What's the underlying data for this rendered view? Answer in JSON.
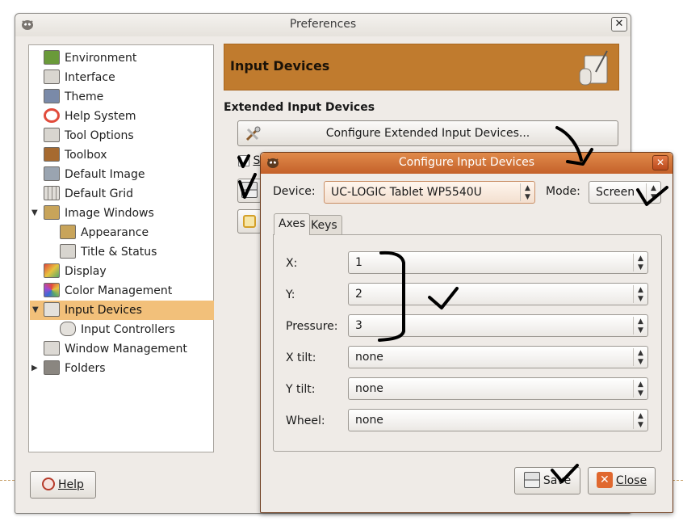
{
  "preferences": {
    "title": "Preferences",
    "close_glyph": "✕",
    "tree": [
      {
        "label": "Environment",
        "icon": "environment-icon",
        "color": "#6a9a3a"
      },
      {
        "label": "Interface",
        "icon": "interface-icon",
        "color": "#d9d6d0"
      },
      {
        "label": "Theme",
        "icon": "theme-icon",
        "color": "#7a8aa8"
      },
      {
        "label": "Help System",
        "icon": "help-system-icon",
        "color": "#e14b3b"
      },
      {
        "label": "Tool Options",
        "icon": "tool-options-icon",
        "color": "#d8d5cf"
      },
      {
        "label": "Toolbox",
        "icon": "toolbox-icon",
        "color": "#a66a30"
      },
      {
        "label": "Default Image",
        "icon": "default-image-icon",
        "color": "#9aa4b0"
      },
      {
        "label": "Default Grid",
        "icon": "default-grid-icon",
        "color": "#e0ddd8"
      },
      {
        "label": "Image Windows",
        "icon": "image-windows-icon",
        "color": "#c8a45a"
      },
      {
        "label": "Appearance",
        "icon": "appearance-icon",
        "color": "#c8a45a"
      },
      {
        "label": "Title & Status",
        "icon": "title-status-icon",
        "color": "#d8d5cf"
      },
      {
        "label": "Display",
        "icon": "display-icon",
        "color": "#c98b3f"
      },
      {
        "label": "Color Management",
        "icon": "color-management-icon",
        "color": "#5aa86a"
      },
      {
        "label": "Input Devices",
        "icon": "input-devices-icon",
        "color": "#e4e1dc"
      },
      {
        "label": "Input Controllers",
        "icon": "input-controllers-icon",
        "color": "#e4e1dc"
      },
      {
        "label": "Window Management",
        "icon": "window-management-icon",
        "color": "#dcd9d4"
      },
      {
        "label": "Folders",
        "icon": "folders-icon",
        "color": "#8a8680"
      }
    ],
    "header_title": "Input Devices",
    "section_title": "Extended Input Devices",
    "configure_button": "Configure Extended Input Devices...",
    "save_partial": "S",
    "help_button": "Help"
  },
  "dialog": {
    "title": "Configure Input Devices",
    "close_glyph": "✕",
    "device_label": "Device:",
    "device_value": "UC-LOGIC Tablet WP5540U",
    "mode_label": "Mode:",
    "mode_value": "Screen",
    "tabs": [
      "Axes",
      "Keys"
    ],
    "axes": [
      {
        "label": "X:",
        "value": "1"
      },
      {
        "label": "Y:",
        "value": "2"
      },
      {
        "label": "Pressure:",
        "value": "3"
      },
      {
        "label": "X tilt:",
        "value": "none"
      },
      {
        "label": "Y tilt:",
        "value": "none"
      },
      {
        "label": "Wheel:",
        "value": "none"
      }
    ],
    "save_button": "Save",
    "close_button": "Close"
  },
  "colors": {
    "header_orange": "#c07b2e",
    "selection": "#f2c07a",
    "dialog_titlebar": "#d47437"
  }
}
